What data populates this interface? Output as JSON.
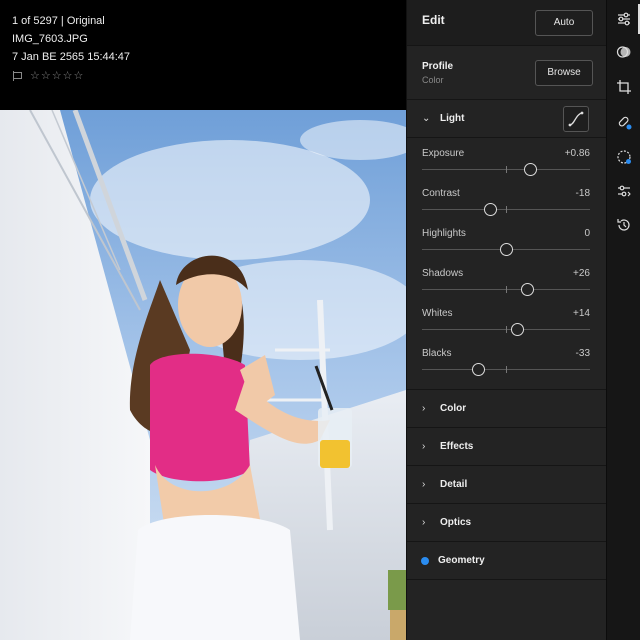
{
  "photo_info": {
    "position": "1 of 5297 | Original",
    "filename": "IMG_7603.JPG",
    "datetime": "7 Jan BE 2565 15:44:47",
    "stars": "☆☆☆☆☆"
  },
  "edit": {
    "title": "Edit",
    "auto_label": "Auto",
    "profile_label": "Profile",
    "profile_value": "Color",
    "browse_label": "Browse"
  },
  "light": {
    "label": "Light",
    "sliders": [
      {
        "label": "Exposure",
        "value": "+0.86",
        "level": 0.643
      },
      {
        "label": "Contrast",
        "value": "-18",
        "level": 0.41
      },
      {
        "label": "Highlights",
        "value": "0",
        "level": 0.5
      },
      {
        "label": "Shadows",
        "value": "+26",
        "level": 0.63
      },
      {
        "label": "Whites",
        "value": "+14",
        "level": 0.57
      },
      {
        "label": "Blacks",
        "value": "-33",
        "level": 0.335
      }
    ]
  },
  "sections": [
    {
      "label": "Color"
    },
    {
      "label": "Effects"
    },
    {
      "label": "Detail"
    },
    {
      "label": "Optics"
    },
    {
      "label": "Geometry"
    }
  ],
  "rail_icons": [
    "sliders-icon",
    "masking-icon",
    "crop-icon",
    "healing-icon",
    "selective-icon",
    "presets-icon",
    "history-icon"
  ],
  "colors": {
    "accent": "#2a8cf0",
    "panel": "#232323",
    "header": "#1d1d1d"
  }
}
